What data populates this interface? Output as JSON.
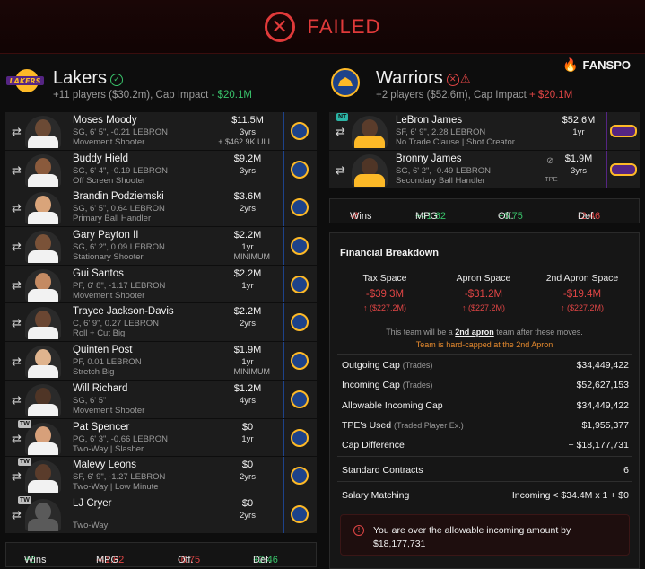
{
  "banner": {
    "status": "FAILED",
    "icon": "x-circle-icon"
  },
  "brand": {
    "name": "FANSPO",
    "icon": "flame-icon"
  },
  "colors": {
    "fail": "#e03a3a",
    "positive": "#39c26a",
    "negative": "#e04545",
    "warning": "#e68a2e",
    "gsw_blue": "#1d428a",
    "lal_purple": "#552583",
    "gold": "#fdb927"
  },
  "lakers": {
    "name": "Lakers",
    "summary": "+11 players ($30.2m), Cap Impact",
    "cap_impact": "- $20.1M",
    "status_icon": "check-circle-icon",
    "players": [
      {
        "name": "Moses Moody",
        "info": "SG, 6' 5\", -0.21 LEBRON",
        "role": "Movement Shooter",
        "salary": "$11.5M",
        "years": "3yrs",
        "note": "+ $462.9K ULI",
        "tag": ""
      },
      {
        "name": "Buddy Hield",
        "info": "SG, 6' 4\", -0.19 LEBRON",
        "role": "Off Screen Shooter",
        "salary": "$9.2M",
        "years": "3yrs",
        "note": "",
        "tag": ""
      },
      {
        "name": "Brandin Podziemski",
        "info": "SG, 6' 5\", 0.64 LEBRON",
        "role": "Primary Ball Handler",
        "salary": "$3.6M",
        "years": "2yrs",
        "note": "",
        "tag": ""
      },
      {
        "name": "Gary Payton II",
        "info": "SG, 6' 2\", 0.09 LEBRON",
        "role": "Stationary Shooter",
        "salary": "$2.2M",
        "years": "1yr",
        "note": "MINIMUM",
        "tag": ""
      },
      {
        "name": "Gui Santos",
        "info": "PF, 6' 8\", -1.17 LEBRON",
        "role": "Movement Shooter",
        "salary": "$2.2M",
        "years": "1yr",
        "note": "",
        "tag": ""
      },
      {
        "name": "Trayce Jackson-Davis",
        "info": "C, 6' 9\", 0.27 LEBRON",
        "role": "Roll + Cut Big",
        "salary": "$2.2M",
        "years": "2yrs",
        "note": "",
        "tag": ""
      },
      {
        "name": "Quinten Post",
        "info": "PF, 0.01 LEBRON",
        "role": "Stretch Big",
        "salary": "$1.9M",
        "years": "1yr",
        "note": "MINIMUM",
        "tag": ""
      },
      {
        "name": "Will Richard",
        "info": "SG, 6' 5\"",
        "role": "Movement Shooter",
        "salary": "$1.2M",
        "years": "4yrs",
        "note": "",
        "tag": ""
      },
      {
        "name": "Pat Spencer",
        "info": "PG, 6' 3\", -0.66 LEBRON",
        "role": "Two-Way | Slasher",
        "salary": "$0",
        "years": "1yr",
        "note": "",
        "tag": "TW"
      },
      {
        "name": "Malevy Leons",
        "info": "SF, 6' 9\", -1.27 LEBRON",
        "role": "Two-Way | Low Minute",
        "salary": "$0",
        "years": "2yrs",
        "note": "",
        "tag": "TW"
      },
      {
        "name": "LJ Cryer",
        "info": "",
        "role": "Two-Way",
        "salary": "$0",
        "years": "2yrs",
        "note": "",
        "tag": "TW"
      }
    ],
    "stats": {
      "wins": "+6",
      "wins_label": "Wins",
      "mpg": "-41.62",
      "mpg_label": "MPG",
      "off": "-6.75",
      "off_label": "Off.",
      "def": "+2.46",
      "def_label": "Def."
    }
  },
  "warriors": {
    "name": "Warriors",
    "summary": "+2 players ($52.6m), Cap Impact",
    "cap_impact": "+ $20.1M",
    "status_icons": [
      "x-circle-icon",
      "warning-icon"
    ],
    "players": [
      {
        "name": "LeBron James",
        "info": "SF, 6' 9\", 2.28 LEBRON",
        "role": "No Trade Clause | Shot Creator",
        "salary": "$52.6M",
        "years": "1yr",
        "tag": "NT",
        "tpe": ""
      },
      {
        "name": "Bronny James",
        "info": "SG, 6' 2\", -0.49 LEBRON",
        "role": "Secondary Ball Handler",
        "salary": "$1.9M",
        "years": "3yrs",
        "tag": "",
        "tpe": "TPE"
      }
    ],
    "stats": {
      "wins": "-6",
      "wins_label": "Wins",
      "mpg": "+41.62",
      "mpg_label": "MPG",
      "off": "+6.75",
      "off_label": "Off.",
      "def": "-2.46",
      "def_label": "Def."
    }
  },
  "financial": {
    "title": "Financial Breakdown",
    "columns": [
      {
        "header": "Tax Space",
        "value": "-$39.3M",
        "sub": "↑ ($227.2M)"
      },
      {
        "header": "Apron Space",
        "value": "-$31.2M",
        "sub": "↑ ($227.2M)"
      },
      {
        "header": "2nd Apron Space",
        "value": "-$19.4M",
        "sub": "↑ ($227.2M)"
      }
    ],
    "note_prefix": "This team will be a",
    "note_emph": "2nd apron",
    "note_suffix": "team after these moves.",
    "hard_cap_note": "Team is hard-capped at the 2nd Apron",
    "rows": [
      {
        "label": "Outgoing Cap",
        "sub": "(Trades)",
        "value": "$34,449,422"
      },
      {
        "label": "Incoming Cap",
        "sub": "(Trades)",
        "value": "$52,627,153"
      },
      {
        "label": "Allowable Incoming Cap",
        "sub": "",
        "value": "$34,449,422"
      },
      {
        "label": "TPE's Used",
        "sub": "(Traded Player Ex.)",
        "value": "$1,955,377"
      },
      {
        "label": "Cap Difference",
        "sub": "",
        "value": "+ $18,177,731"
      }
    ],
    "standard_contracts": {
      "label": "Standard Contracts",
      "value": "6"
    },
    "salary_matching": {
      "label": "Salary Matching",
      "value": "Incoming < $34.4M x 1 + $0"
    },
    "alert": "You are over the allowable incoming amount by $18,177,731"
  }
}
